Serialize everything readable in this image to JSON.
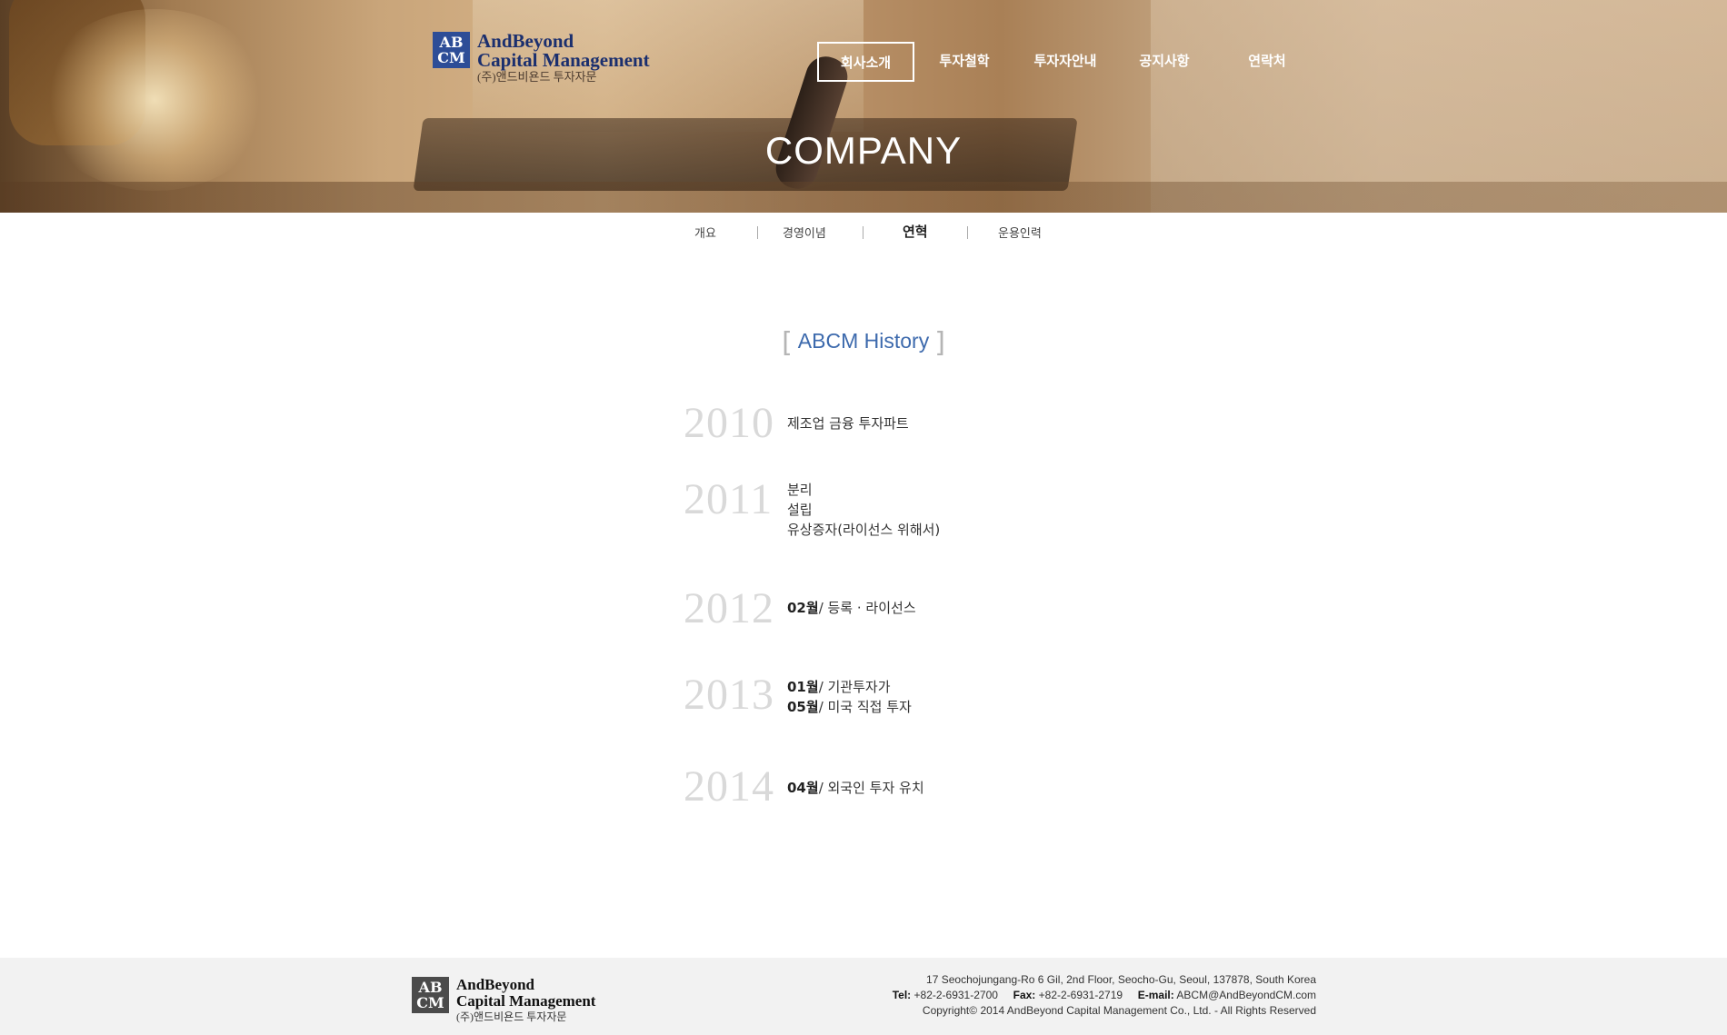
{
  "header": {
    "logo": {
      "mark": [
        "AB",
        "CM"
      ],
      "line1": "AndBeyond",
      "line2": "Capital Management",
      "line3": "(주)앤드비욘드 투자자문"
    },
    "nav": [
      {
        "label": "회사소개",
        "active": true
      },
      {
        "label": "투자철학",
        "active": false
      },
      {
        "label": "투자자안내",
        "active": false
      },
      {
        "label": "공지사항",
        "active": false
      },
      {
        "label": "연락처",
        "active": false
      }
    ],
    "page_title": "COMPANY"
  },
  "subnav": [
    {
      "label": "개요",
      "active": false
    },
    {
      "label": "경영이념",
      "active": false
    },
    {
      "label": "연혁",
      "active": true
    },
    {
      "label": "운용인력",
      "active": false
    }
  ],
  "history": {
    "title": "ABCM History",
    "entries": [
      {
        "year": "2010",
        "events": [
          {
            "month": "",
            "text": "제조업 금융 투자파트"
          }
        ]
      },
      {
        "year": "2011",
        "events": [
          {
            "month": "",
            "text": "분리"
          },
          {
            "month": "",
            "text": "설립"
          },
          {
            "month": "",
            "text": "유상증자(라이선스 위해서)"
          }
        ]
      },
      {
        "year": "2012",
        "events": [
          {
            "month": "02월",
            "text": "/ 등록 · 라이선스"
          }
        ]
      },
      {
        "year": "2013",
        "events": [
          {
            "month": "01월",
            "text": "/ 기관투자가"
          },
          {
            "month": "05월",
            "text": "/ 미국 직접 투자"
          }
        ]
      },
      {
        "year": "2014",
        "events": [
          {
            "month": "04월",
            "text": "/ 외국인 투자 유치"
          }
        ]
      }
    ]
  },
  "footer": {
    "logo": {
      "mark": [
        "AB",
        "CM"
      ],
      "line1": "AndBeyond",
      "line2": "Capital Management",
      "line3": "(주)앤드비욘드 투자자문"
    },
    "address": "17 Seochojungang-Ro 6 Gil, 2nd Floor, Seocho-Gu, Seoul, 137878, South Korea",
    "tel_label": "Tel:",
    "tel": "+82-2-6931-2700",
    "fax_label": "Fax:",
    "fax": "+82-2-6931-2719",
    "email_label": "E-mail:",
    "email": "ABCM@AndBeyondCM.com",
    "copyright": "Copyright© 2014 AndBeyond Capital Management Co., Ltd. - All Rights Reserved"
  },
  "colors": {
    "brand_navy": "#2d4d97",
    "history_title": "#3d6aad",
    "year_gray": "#d9d9d9",
    "footer_bg": "#f2f2f2"
  }
}
